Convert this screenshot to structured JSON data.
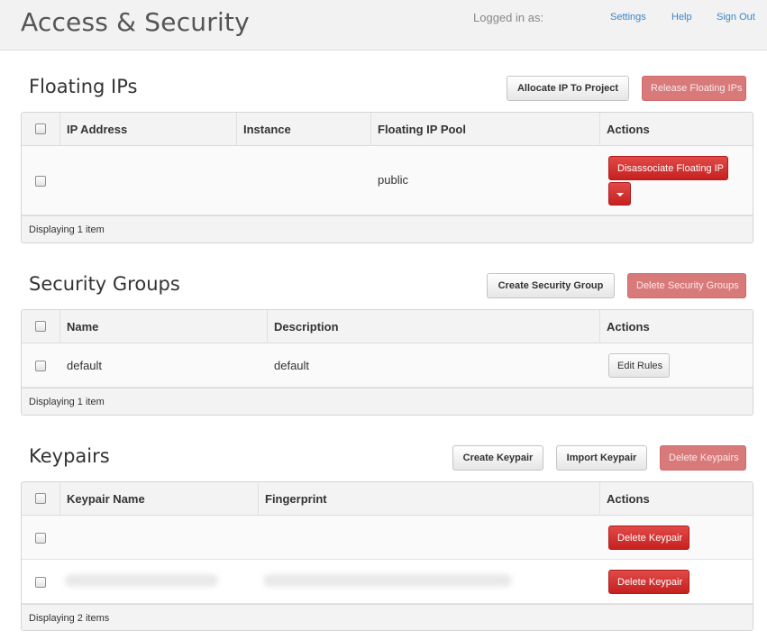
{
  "header": {
    "title": "Access & Security",
    "logged_in_label": "Logged in as:",
    "links": {
      "settings": "Settings",
      "help": "Help",
      "sign_out": "Sign Out"
    }
  },
  "floating_ips": {
    "title": "Floating IPs",
    "allocate_label": "Allocate IP To Project",
    "release_label": "Release Floating IPs",
    "columns": [
      "IP Address",
      "Instance",
      "Floating IP Pool",
      "Actions"
    ],
    "rows": [
      {
        "ip_address": "",
        "instance": "",
        "pool": "public",
        "action_label": "Disassociate Floating IP"
      }
    ],
    "footer": "Displaying 1 item"
  },
  "security_groups": {
    "title": "Security Groups",
    "create_label": "Create Security Group",
    "delete_label": "Delete Security Groups",
    "columns": [
      "Name",
      "Description",
      "Actions"
    ],
    "rows": [
      {
        "name": "default",
        "description": "default",
        "action_label": "Edit Rules"
      }
    ],
    "footer": "Displaying 1 item"
  },
  "keypairs": {
    "title": "Keypairs",
    "create_label": "Create Keypair",
    "import_label": "Import Keypair",
    "delete_label": "Delete Keypairs",
    "columns": [
      "Keypair Name",
      "Fingerprint",
      "Actions"
    ],
    "rows": [
      {
        "name": "",
        "fingerprint": "",
        "action_label": "Delete Keypair"
      },
      {
        "name": "",
        "fingerprint": "",
        "action_label": "Delete Keypair"
      }
    ],
    "footer": "Displaying 2 items"
  },
  "colors": {
    "link": "#3d84c6",
    "danger": "#c5211f",
    "danger_faded": "#d8797a",
    "header_bg": "#f2f2f2"
  }
}
